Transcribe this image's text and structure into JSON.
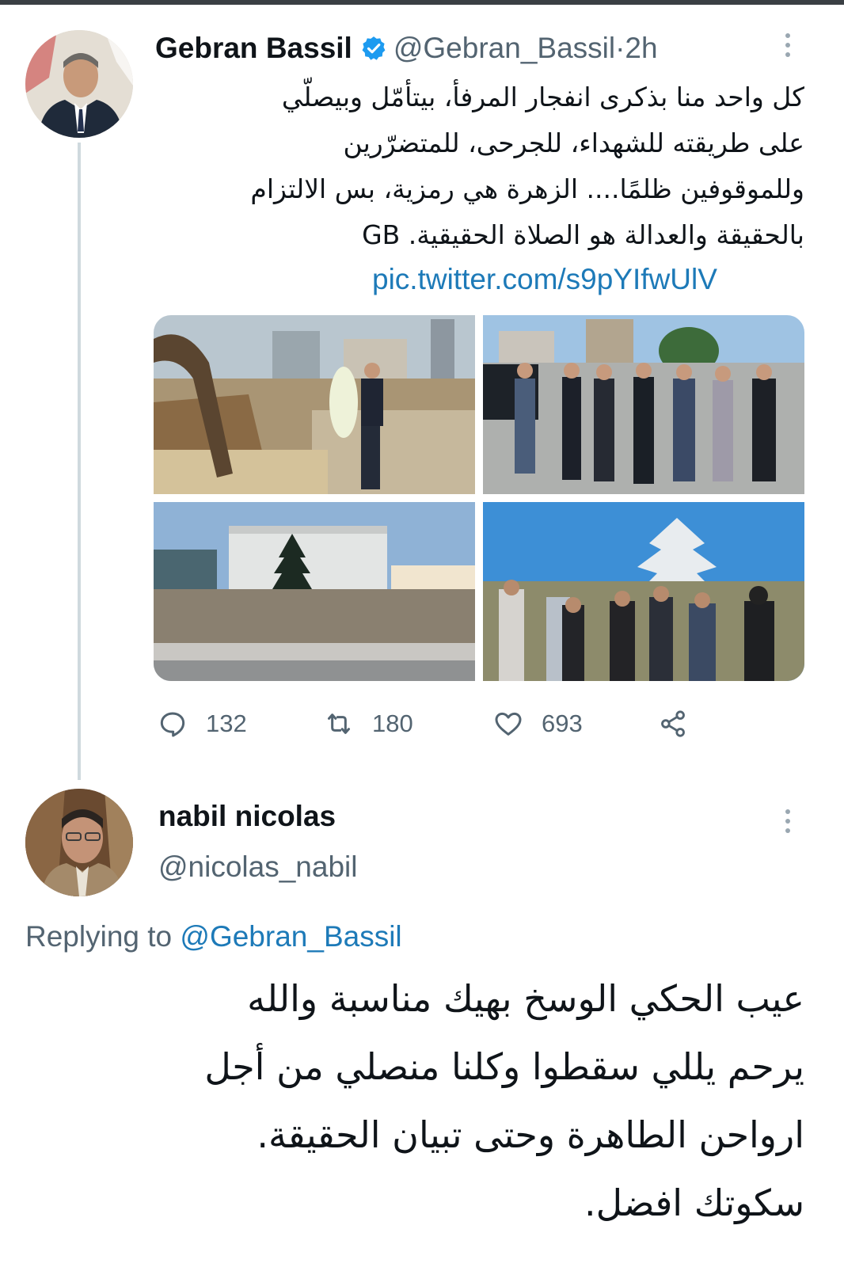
{
  "tweet": {
    "display_name": "Gebran Bassil",
    "handle": "@Gebran_Bassil",
    "separator": " · ",
    "time": "2h",
    "text_lines": [
      "كل واحد منا بذكرى انفجار المرفأ، بيتأمّل وبيصلّي",
      "على طريقته للشهداء، للجرحى، للمتضرّرين",
      "وللموقوفين ظلمًا.... الزهرة هي رمزية، بس الالتزام",
      "بالحقيقة والعدالة هو الصلاة الحقيقية. GB"
    ],
    "link": "pic.twitter.com/s9pYIfwUlV",
    "stats": {
      "replies": "132",
      "retweets": "180",
      "likes": "693"
    }
  },
  "reply": {
    "display_name": "nabil nicolas",
    "handle": "@nicolas_nabil",
    "replying_prefix": "Replying to ",
    "replying_to": "@Gebran_Bassil",
    "text_lines": [
      "عيب الحكي الوسخ بهيك مناسبة والله",
      "يرحم يللي سقطوا وكلنا منصلي من أجل",
      "ارواحن الطاهرة وحتى تبيان الحقيقة.",
      "سكوتك افضل."
    ]
  },
  "colors": {
    "text": "#0f1419",
    "muted": "#536471",
    "link": "#1d7ab8",
    "verified": "#1d9bf0"
  },
  "icons": [
    "verified-icon",
    "more-icon",
    "reply-icon",
    "retweet-icon",
    "like-icon",
    "share-icon"
  ]
}
